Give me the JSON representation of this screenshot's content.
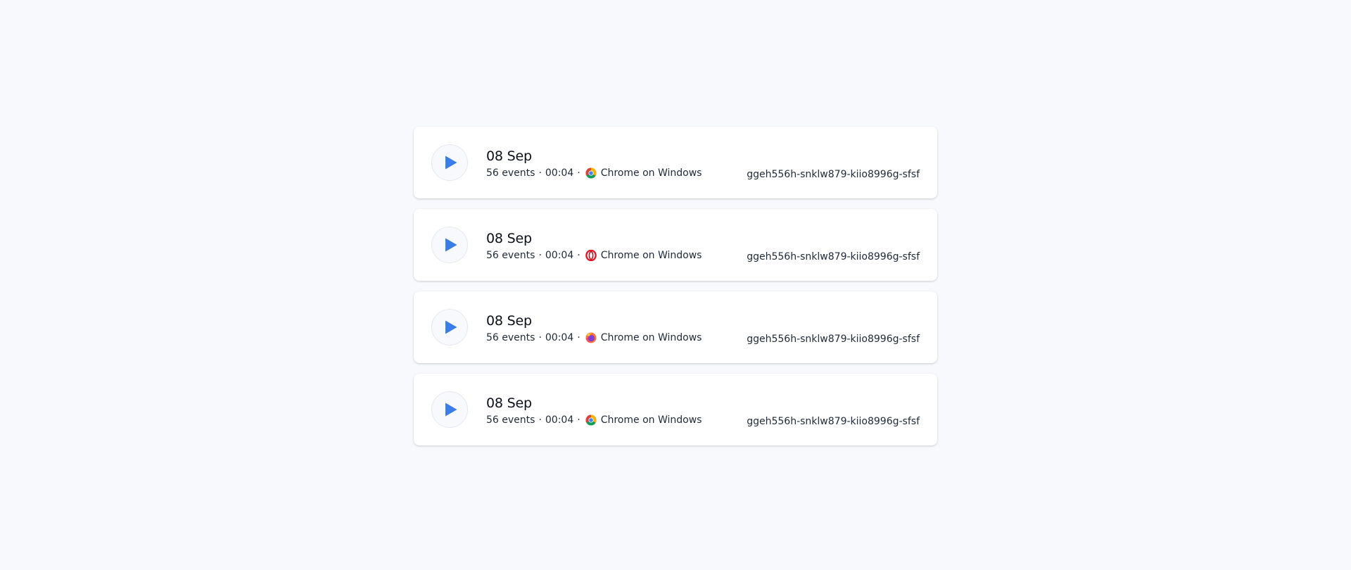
{
  "colors": {
    "accent": "#3b7de6",
    "background": "#f8f9fc",
    "card": "#ffffff"
  },
  "sessions": [
    {
      "date": "08 Sep",
      "events": "56 events",
      "duration": "00:04",
      "browser_icon": "chrome-icon",
      "browser_label": "Chrome on Windows",
      "session_id": "ggeh556h-snklw879-kiio8996g-sfsf"
    },
    {
      "date": "08 Sep",
      "events": "56 events",
      "duration": "00:04",
      "browser_icon": "opera-icon",
      "browser_label": "Chrome on Windows",
      "session_id": "ggeh556h-snklw879-kiio8996g-sfsf"
    },
    {
      "date": "08 Sep",
      "events": "56 events",
      "duration": "00:04",
      "browser_icon": "firefox-icon",
      "browser_label": "Chrome on Windows",
      "session_id": "ggeh556h-snklw879-kiio8996g-sfsf"
    },
    {
      "date": "08 Sep",
      "events": "56 events",
      "duration": "00:04",
      "browser_icon": "chrome-icon",
      "browser_label": "Chrome on Windows",
      "session_id": "ggeh556h-snklw879-kiio8996g-sfsf"
    }
  ]
}
